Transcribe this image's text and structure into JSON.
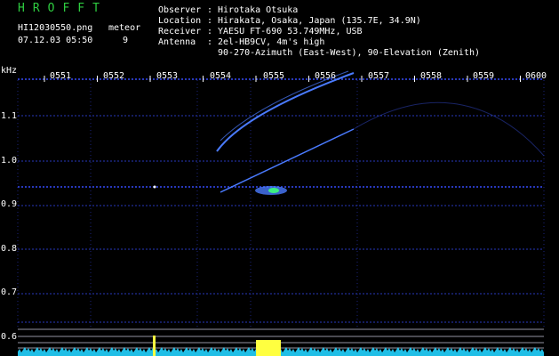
{
  "header": {
    "logo": "HROFFT",
    "filename": "HI12030550.png",
    "date_time": "07.12.03 05:50",
    "meteor_label": "meteor",
    "meteor_count": "9",
    "observer_key": "Observer",
    "observer_val": "Hirotaka Otsuka",
    "location_key": "Location",
    "location_val": "Hirakata, Osaka, Japan (135.7E, 34.9N)",
    "receiver_key": "Receiver",
    "receiver_val": "YAESU FT-690 53.749MHz, USB",
    "antenna_key": "Antenna",
    "antenna_val1": "2el-HB9CV, 4m's high",
    "antenna_val2": "90-270-Azimuth (East-West), 90-Elevation (Zenith)"
  },
  "axis": {
    "y_unit": "kHz",
    "time_ticks": [
      "0551",
      "0552",
      "0553",
      "0554",
      "0555",
      "0556",
      "0557",
      "0558",
      "0559",
      "0600"
    ],
    "freq_ticks": [
      "1.1",
      "1.0",
      "0.9",
      "0.8",
      "0.7",
      "0.6"
    ]
  },
  "colors": {
    "background": "#000000",
    "grid_dot": "#2d3fd0",
    "signal": "#4a7bff",
    "meteor_core": "#ffff40",
    "spectrum": "#22d3ff",
    "logo": "#2ecc40"
  }
}
